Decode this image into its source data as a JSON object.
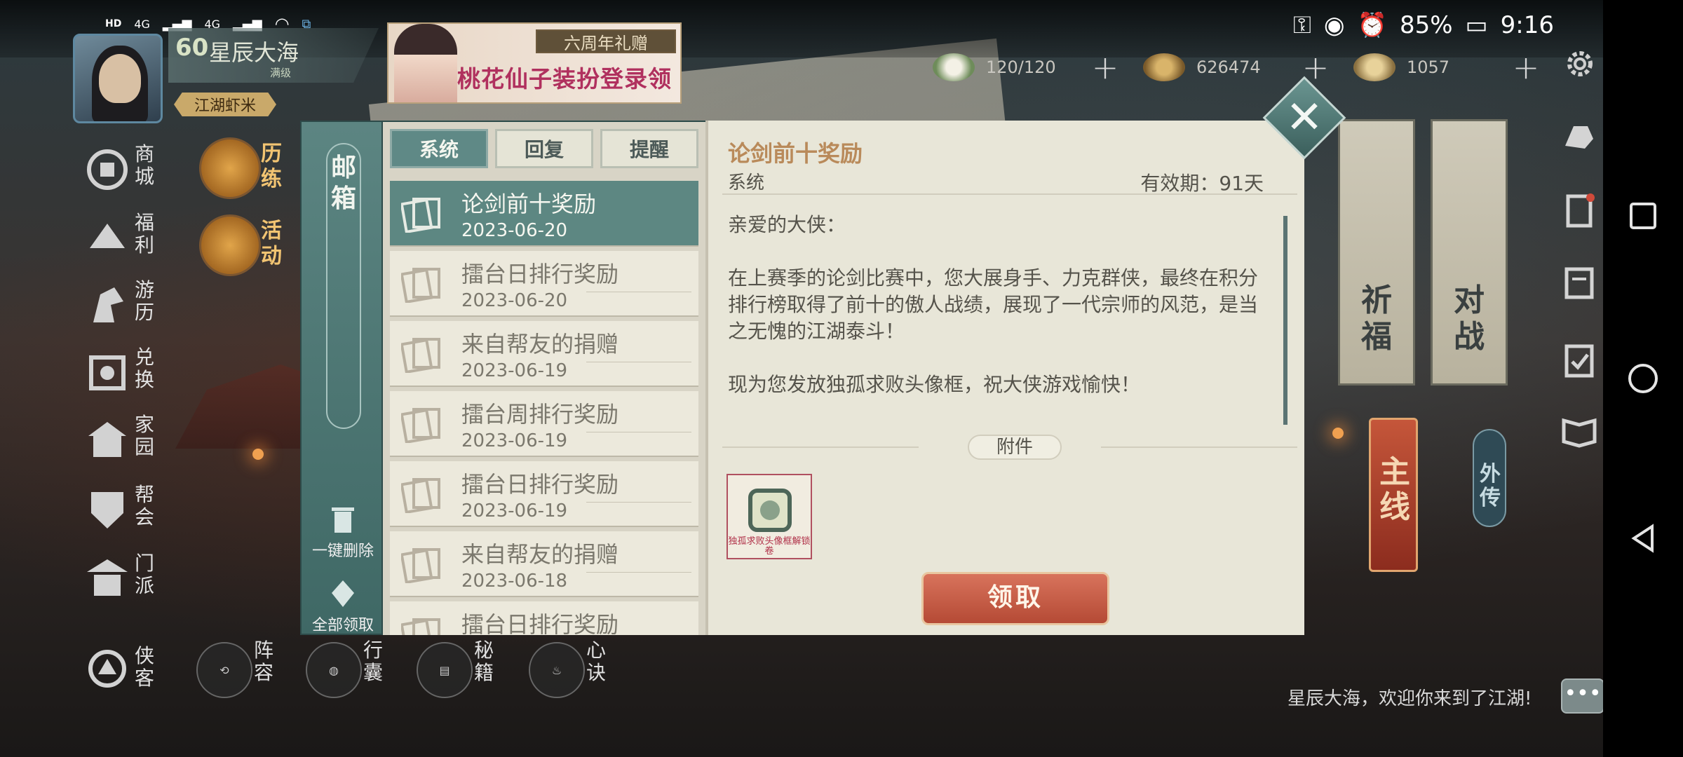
{
  "status_bar": {
    "network": "4G",
    "network2": "4G",
    "battery": "85%",
    "time": "9:16",
    "hd1": "HD",
    "hd2": "HD"
  },
  "player": {
    "level": "60",
    "name": "星辰大海",
    "level_sub": "满级",
    "title_badge": "江湖虾米"
  },
  "event_banner": {
    "tag": "六周年礼赠",
    "text": "桃花仙子装扮登录领"
  },
  "currencies": [
    {
      "icon": "dumpling-icon",
      "value": "120/120"
    },
    {
      "icon": "coin-pile-icon",
      "value": "626474"
    },
    {
      "icon": "gold-ingot-icon",
      "value": "1057"
    }
  ],
  "left_menu": [
    {
      "label": "商城",
      "icon": "shop-icon"
    },
    {
      "label": "福利",
      "icon": "welfare-icon"
    },
    {
      "label": "游历",
      "icon": "horse-icon"
    },
    {
      "label": "兑换",
      "icon": "exchange-icon"
    },
    {
      "label": "家园",
      "icon": "home-icon"
    },
    {
      "label": "帮会",
      "icon": "guild-icon"
    },
    {
      "label": "门派",
      "icon": "sect-icon"
    },
    {
      "label": "侠客",
      "icon": "hero-icon"
    }
  ],
  "round_buttons": [
    {
      "label": "历练",
      "icon": "lotus-icon"
    },
    {
      "label": "活动",
      "icon": "lantern-icon"
    }
  ],
  "bottom_menu": [
    {
      "label": "阵容",
      "icon": "formation-icon"
    },
    {
      "label": "行囊",
      "icon": "bag-icon"
    },
    {
      "label": "秘籍",
      "icon": "book-icon"
    },
    {
      "label": "心诀",
      "icon": "flame-icon"
    }
  ],
  "right_panel": {
    "pillar1": "祈福",
    "pillar2": "对战",
    "main_quest": "主线",
    "side_quest": "外传"
  },
  "chat": {
    "message": "星辰大海，欢迎你来到了江湖!",
    "button": "•••"
  },
  "mailbox": {
    "title": "邮箱",
    "delete_all": "一键删除",
    "claim_all": "全部领取",
    "tabs": [
      "系统",
      "回复",
      "提醒"
    ],
    "active_tab": "系统",
    "items": [
      {
        "title": "论剑前十奖励",
        "date": "2023-06-20",
        "active": true
      },
      {
        "title": "擂台日排行奖励",
        "date": "2023-06-20",
        "active": false
      },
      {
        "title": "来自帮友的捐赠",
        "date": "2023-06-19",
        "active": false
      },
      {
        "title": "擂台周排行奖励",
        "date": "2023-06-19",
        "active": false
      },
      {
        "title": "擂台日排行奖励",
        "date": "2023-06-19",
        "active": false
      },
      {
        "title": "来自帮友的捐赠",
        "date": "2023-06-18",
        "active": false
      },
      {
        "title": "擂台日排行奖励",
        "date": "",
        "active": false
      }
    ],
    "detail": {
      "subject": "论剑前十奖励",
      "sender": "系统",
      "expiry": "有效期：91天",
      "greeting": "亲爱的大侠：",
      "paragraph1": "在上赛季的论剑比赛中，您大展身手、力克群侠，最终在积分排行榜取得了前十的傲人战绩，展现了一代宗师的风范，是当之无愧的江湖泰斗！",
      "paragraph2": "现为您发放独孤求败头像框，祝大侠游戏愉快！",
      "attachment_label": "附件",
      "attachment_caption": "独孤求败头像框解锁卷",
      "claim_button": "领取"
    },
    "close": "✕"
  },
  "colors": {
    "accent_teal": "#5f8986",
    "claim_red": "#c45a42",
    "subject_gold": "#b98a5a",
    "panel_bg": "#e8e6d8"
  }
}
